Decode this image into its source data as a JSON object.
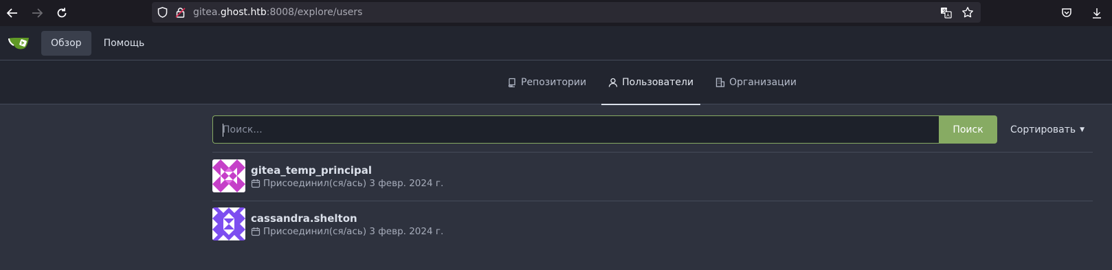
{
  "browser": {
    "url_prefix": "gitea.",
    "url_host": "ghost.htb",
    "url_suffix": ":8008/explore/users"
  },
  "header": {
    "nav": [
      {
        "label": "Обзор",
        "active": true
      },
      {
        "label": "Помощь",
        "active": false
      }
    ]
  },
  "tabs": [
    {
      "label": "Репозитории",
      "icon": "repo-icon",
      "active": false
    },
    {
      "label": "Пользователи",
      "icon": "person-icon",
      "active": true
    },
    {
      "label": "Организации",
      "icon": "organization-icon",
      "active": false
    }
  ],
  "search": {
    "placeholder": "Поиск...",
    "value": "",
    "button_label": "Поиск",
    "sort_label": "Сортировать"
  },
  "users": [
    {
      "name": "gitea_temp_principal",
      "joined": "Присоединил(ся/ась) 3 февр. 2024 г.",
      "avatar_colors": [
        "#c53fc8",
        "#ffffff"
      ]
    },
    {
      "name": "cassandra.shelton",
      "joined": "Присоединил(ся/ась) 3 февр. 2024 г.",
      "avatar_colors": [
        "#7d4ef0",
        "#ffffff"
      ]
    }
  ],
  "colors": {
    "accent_green": "#87ab63",
    "background": "#2e323e",
    "header_bg": "#22252f"
  }
}
